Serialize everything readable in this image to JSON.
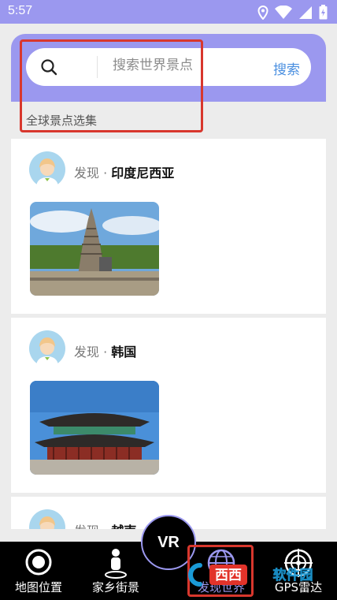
{
  "status": {
    "time": "5:57"
  },
  "search": {
    "placeholder": "搜索世界景点",
    "button_label": "搜索"
  },
  "section": {
    "title": "全球景点选集"
  },
  "feed": [
    {
      "prefix": "发现",
      "separator": " · ",
      "location": "印度尼西亚"
    },
    {
      "prefix": "发现",
      "separator": " · ",
      "location": "韩国"
    },
    {
      "prefix": "发现",
      "separator": " · ",
      "location": "越南"
    }
  ],
  "tabs": [
    {
      "label": "地图位置",
      "icon": "map-location-icon"
    },
    {
      "label": "家乡街景",
      "icon": "street-view-person-icon"
    },
    {
      "label": "VR",
      "icon": "vr-icon"
    },
    {
      "label": "发现世界",
      "icon": "globe-icon"
    },
    {
      "label": "GPS雷达",
      "icon": "radar-icon"
    }
  ],
  "watermark": {
    "text": "西西软件园"
  },
  "colors": {
    "accent": "#9b98ef",
    "link": "#4a8fe0",
    "highlight": "#d8372d"
  }
}
